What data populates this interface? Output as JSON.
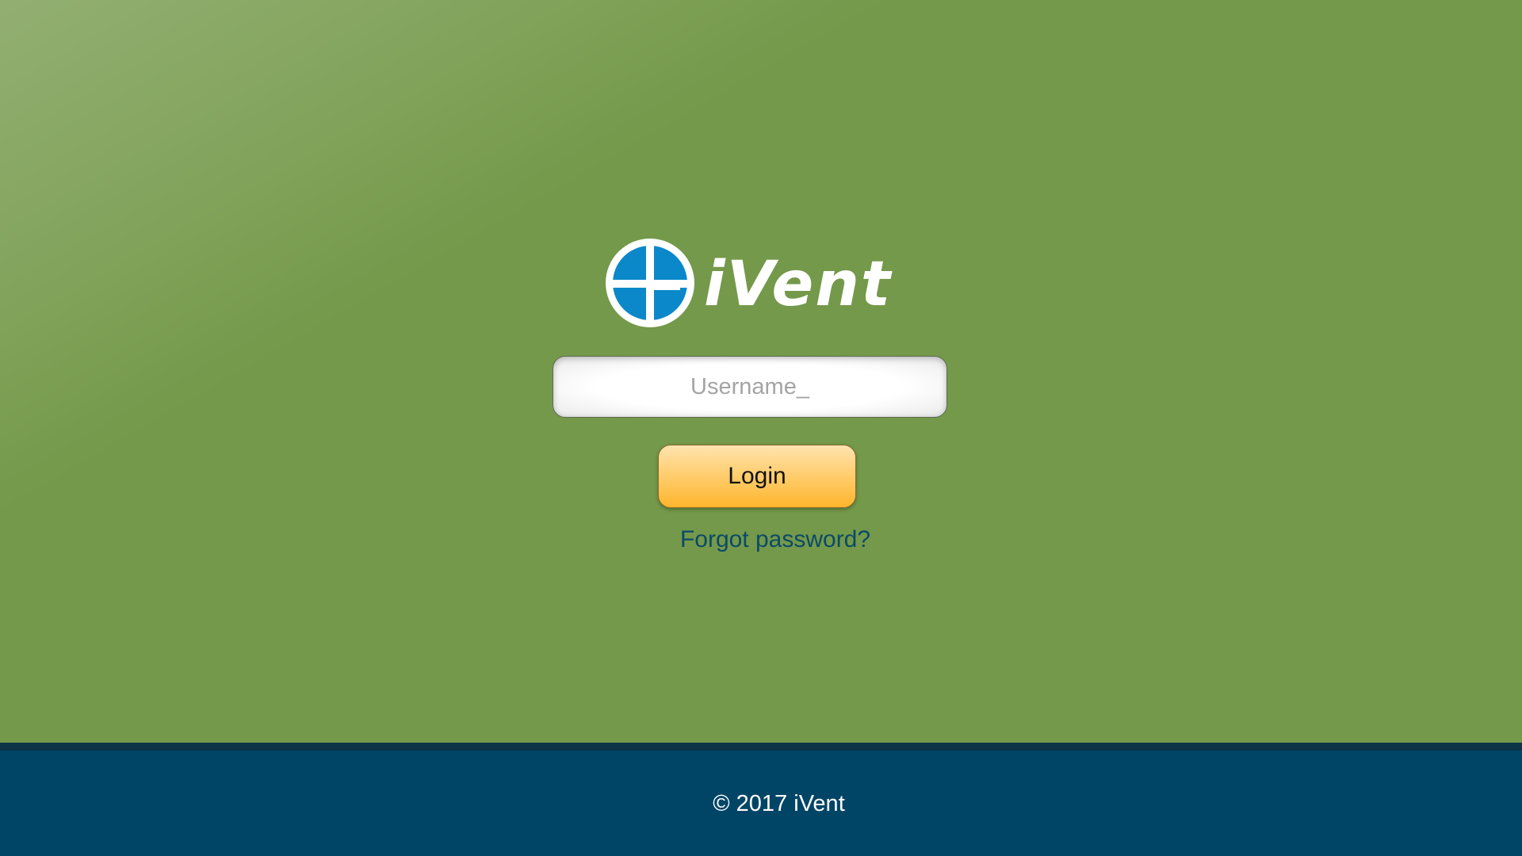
{
  "brand": {
    "name": "iVent",
    "logo_icon": "ivent-logo-icon",
    "logo_colors": {
      "circle": "#ffffff",
      "quadrants": "#0b88c9"
    }
  },
  "login_form": {
    "username_placeholder": "Username_",
    "username_value": "",
    "login_label": "Login",
    "forgot_password_label": "Forgot password?"
  },
  "footer": {
    "copyright": "© 2017 iVent"
  },
  "colors": {
    "background": "#74994a",
    "footer": "#004566",
    "footer_line": "#0c3548",
    "button_top": "#ffe3b0",
    "button_bottom": "#ffb52d",
    "link": "#0b4a68"
  }
}
